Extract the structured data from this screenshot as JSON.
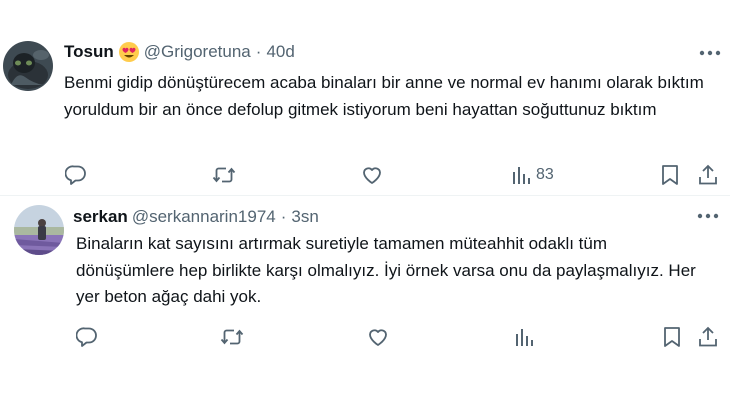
{
  "tweets": [
    {
      "display_name": "Tosun",
      "handle": "@Grigoretuna",
      "separator": "·",
      "time": "40d",
      "emoji_icon": "heart-eyes-emoji-icon",
      "text": "Benmi gidip dönüştürecem acaba binaları bir anne ve normal ev hanımı olarak bıktım yoruldum bir an önce defolup gitmek istiyorum beni hayattan soğuttunuz bıktım",
      "views": "83"
    },
    {
      "display_name": "serkan",
      "handle": "@serkannarin1974",
      "separator": "·",
      "time": "3sn",
      "text": "Binaların kat sayısını artırmak suretiyle tamamen müteahhit odaklı tüm dönüşümlere hep birlikte karşı olmalıyız. İyi örnek varsa onu da paylaşmalıyız. Her yer beton ağaç dahi yok.",
      "views": ""
    }
  ],
  "icons": {
    "reply": "reply-icon",
    "retweet": "retweet-icon",
    "like": "like-icon",
    "views": "views-icon",
    "bookmark": "bookmark-icon",
    "share": "share-icon",
    "more": "more-icon"
  },
  "colors": {
    "text": "#0f1419",
    "secondary": "#536471",
    "divider": "#eff3f4"
  }
}
